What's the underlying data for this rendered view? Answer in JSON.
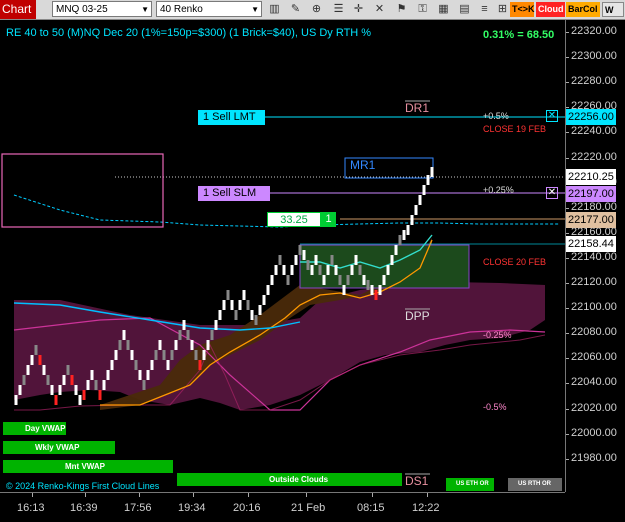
{
  "toolbar": {
    "title": "Chart",
    "instrument": "MNQ 03-25",
    "bar_type": "40 Renko",
    "buttons": [
      "bar-style",
      "draw",
      "zoom",
      "properties",
      "crosshair",
      "strategy",
      "alerts",
      "lock",
      "tile",
      "restore"
    ],
    "tool_labels": {
      "tpk": "T<>K",
      "cloud": "Cloud",
      "barcol": "BarCol",
      "w": "W"
    }
  },
  "chart": {
    "title": "RE 40 to 50 (M)NQ Dec 20 (1%=150p=$300) (1 Brick=$40), US Dy RTH %",
    "pct_readout": "0.31% = 68.50",
    "copyright": "© 2024 Renko-Kings First Cloud Lines"
  },
  "price_axis": {
    "ticks": [
      "22320.00",
      "22300.00",
      "22280.00",
      "22260.00",
      "22240.00",
      "22220.00",
      "22200.00",
      "22180.00",
      "22160.00",
      "22140.00",
      "22120.00",
      "22100.00",
      "22080.00",
      "22060.00",
      "22040.00",
      "22020.00",
      "22000.00",
      "21980.00"
    ],
    "labels": {
      "sell_lmt": "22256.00",
      "last": "22210.25",
      "sell_slm": "22197.00",
      "avg": "22177.00",
      "mid": "22158.44"
    }
  },
  "time_axis": {
    "ticks": [
      "16:13",
      "16:39",
      "17:56",
      "19:34",
      "20:16",
      "21 Feb",
      "08:15",
      "12:22"
    ]
  },
  "orders": {
    "sell_lmt": "1 Sell LMT",
    "sell_slm": "1 Sell SLM",
    "position_pnl": "33.25",
    "position_qty": "1"
  },
  "levels": {
    "dr1": "DR1",
    "mr1": "MR1",
    "dpp": "DPP",
    "ds1": "DS1",
    "plus_05": "+0.5%",
    "plus_025": "+0.25%",
    "minus_025": "-0.25%",
    "minus_05": "-0.5%",
    "close_19": "CLOSE 19 FEB",
    "close_20": "CLOSE 20 FEB"
  },
  "vwap_labels": {
    "day": "Day VWAP",
    "wkly": "Wkly VWAP",
    "mnt": "Mnt VWAP",
    "outside_clouds": "Outside Clouds",
    "us_eth": "US ETH OR",
    "us_rth": "US RTH OR"
  },
  "colors": {
    "cyan": "#00e5ff",
    "violet": "#cc88ff",
    "green": "#00cc33",
    "red": "#ff3333",
    "orange": "#ff9900",
    "magenta": "#cc3399"
  }
}
